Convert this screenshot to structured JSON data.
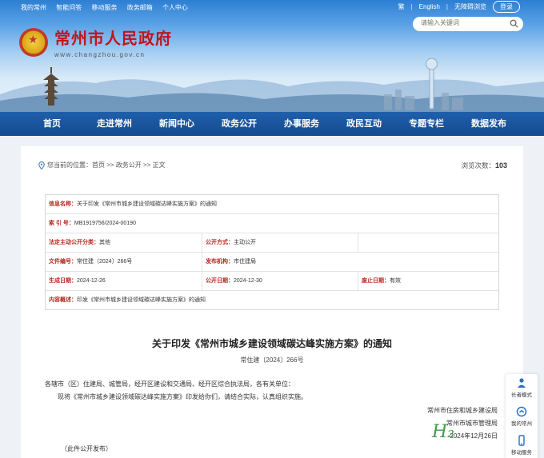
{
  "topbar": {
    "links": [
      "我的常州",
      "智能问答",
      "移动服务",
      "政务邮箱",
      "个人中心"
    ],
    "lang_traditional": "繁",
    "lang_english": "English",
    "accessibility": "无障碍浏览",
    "login": "登录"
  },
  "header": {
    "site_title": "常州市人民政府",
    "site_url": "www.changzhou.gov.cn",
    "search_placeholder": "请输入关键词"
  },
  "nav": [
    "首页",
    "走进常州",
    "新闻中心",
    "政务公开",
    "办事服务",
    "政民互动",
    "专题专栏",
    "数据发布"
  ],
  "breadcrumb": {
    "prefix": "您当前的位置：",
    "items": [
      "首页",
      ">>",
      "政务公开",
      ">>",
      "正文"
    ]
  },
  "views": {
    "label": "浏览次数：",
    "count": "103"
  },
  "meta": {
    "info_name_label": "信息名称：",
    "info_name": "关于印发《常州市城乡建设领域碳达峰实施方案》的通知",
    "index_label": "索  引  号：",
    "index": "MB1919756/2024-00190",
    "category_label": "法定主动公开分类：",
    "category": "其他",
    "open_mode_label": "公开方式：",
    "open_mode": "主动公开",
    "doc_no_label": "文件编号：",
    "doc_no": "常住建〔2024〕266号",
    "issuer_label": "发布机构：",
    "issuer": "市住建局",
    "effective_label": "生成日期：",
    "effective": "2024-12-26",
    "publish_label": "公开日期：",
    "publish": "2024-12-30",
    "abolish_label": "废止日期：",
    "abolish": "有效",
    "summary_label": "内容概述：",
    "summary": "印发《常州市城乡建设领域碳达峰实施方案》的通知"
  },
  "doc": {
    "title": "关于印发《常州市城乡建设领域碳达峰实施方案》的通知",
    "number": "常住建〔2024〕266号",
    "addressee": "各辖市（区）住建局、城管局，经开区建设和交通局、经开区综合执法局，各有关单位：",
    "body": "现将《常州市城乡建设领域碳达峰实施方案》印发给你们，请结合实际，认真组织实施。",
    "sign_1": "常州市住房和城乡建设局",
    "sign_2": "常州市城市管理局",
    "sign_date": "2024年12月26日",
    "note": "（此件公开发布）"
  },
  "side_tools": [
    "长者模式",
    "我的常州",
    "移动服务"
  ],
  "watermark": "H₂"
}
